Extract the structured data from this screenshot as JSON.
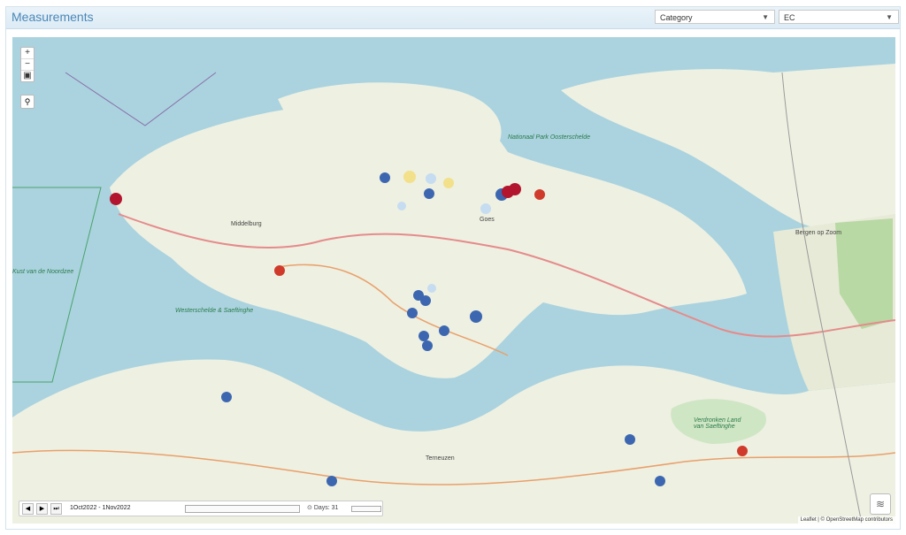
{
  "header": {
    "title": "Measurements"
  },
  "controls": {
    "category_select": "Category",
    "parameter_select": "EC"
  },
  "map": {
    "zoom_in": "+",
    "zoom_out": "−",
    "fullscreen": "▣",
    "locate": "⚲",
    "layers_icon": "layers-icon",
    "attribution": "Leaflet | © OpenStreetMap contributors",
    "labels": {
      "sea_north": "Kust van de Noordzee",
      "sea_left": "Kust van de Noordzee",
      "westerschelde": "Westerschelde & Saeftinghe",
      "oosterschelde": "Nationaal Park Oosterschelde",
      "middelburg": "Middelburg",
      "goes": "Goes",
      "saeftinghe": "Verdronken Land van Saeftinghe",
      "terneuzen": "Terneuzen",
      "bergen": "Bergen op Zoom"
    }
  },
  "timeline": {
    "prev": "◀",
    "play": "▶",
    "next": "⏭",
    "range": "1Oct2022 - 1Nov2022",
    "speed_label": "Days: 31"
  },
  "colors": {
    "blue": "#3c67b0",
    "red": "#d03a2a",
    "darkred": "#b2152d",
    "yellow": "#f3e08a",
    "lightblue": "#c6dcf1"
  }
}
